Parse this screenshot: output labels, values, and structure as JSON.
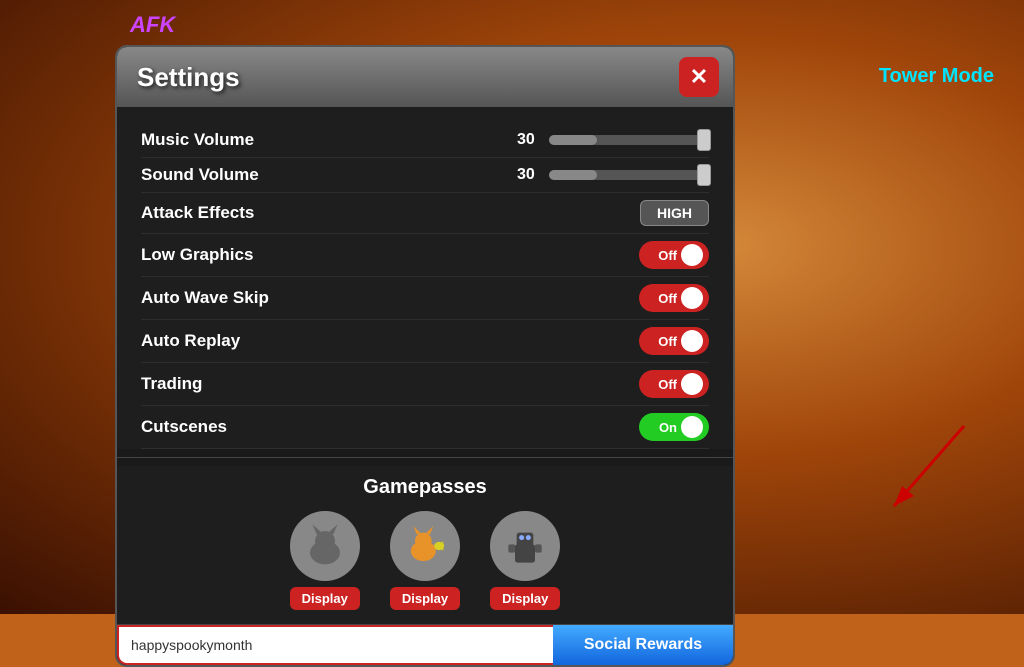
{
  "afk": {
    "label": "AFK"
  },
  "tower_mode": {
    "label": "Tower Mode"
  },
  "settings": {
    "title": "Settings",
    "close_label": "✕",
    "rows": [
      {
        "id": "music-volume",
        "label": "Music Volume",
        "control": "slider",
        "value": "30",
        "fill_percent": 30
      },
      {
        "id": "sound-volume",
        "label": "Sound Volume",
        "control": "slider",
        "value": "30",
        "fill_percent": 30
      },
      {
        "id": "attack-effects",
        "label": "Attack Effects",
        "control": "high-button",
        "value": "HIGH"
      },
      {
        "id": "low-graphics",
        "label": "Low Graphics",
        "control": "toggle",
        "value": "Off",
        "state": "off"
      },
      {
        "id": "auto-wave-skip",
        "label": "Auto Wave Skip",
        "control": "toggle",
        "value": "Off",
        "state": "off"
      },
      {
        "id": "auto-replay",
        "label": "Auto Replay",
        "control": "toggle",
        "value": "Off",
        "state": "off"
      },
      {
        "id": "trading",
        "label": "Trading",
        "control": "toggle",
        "value": "Off",
        "state": "off"
      },
      {
        "id": "cutscenes",
        "label": "Cutscenes",
        "control": "toggle",
        "value": "On",
        "state": "on"
      }
    ]
  },
  "gamepasses": {
    "title": "Gamepasses",
    "items": [
      {
        "id": "gp1",
        "label": "Display"
      },
      {
        "id": "gp2",
        "label": "Display"
      },
      {
        "id": "gp3",
        "label": "Display"
      }
    ]
  },
  "bottom": {
    "promo_placeholder": "happyspookymonth",
    "promo_value": "happyspookymonth",
    "social_rewards_label": "Social Rewards"
  }
}
